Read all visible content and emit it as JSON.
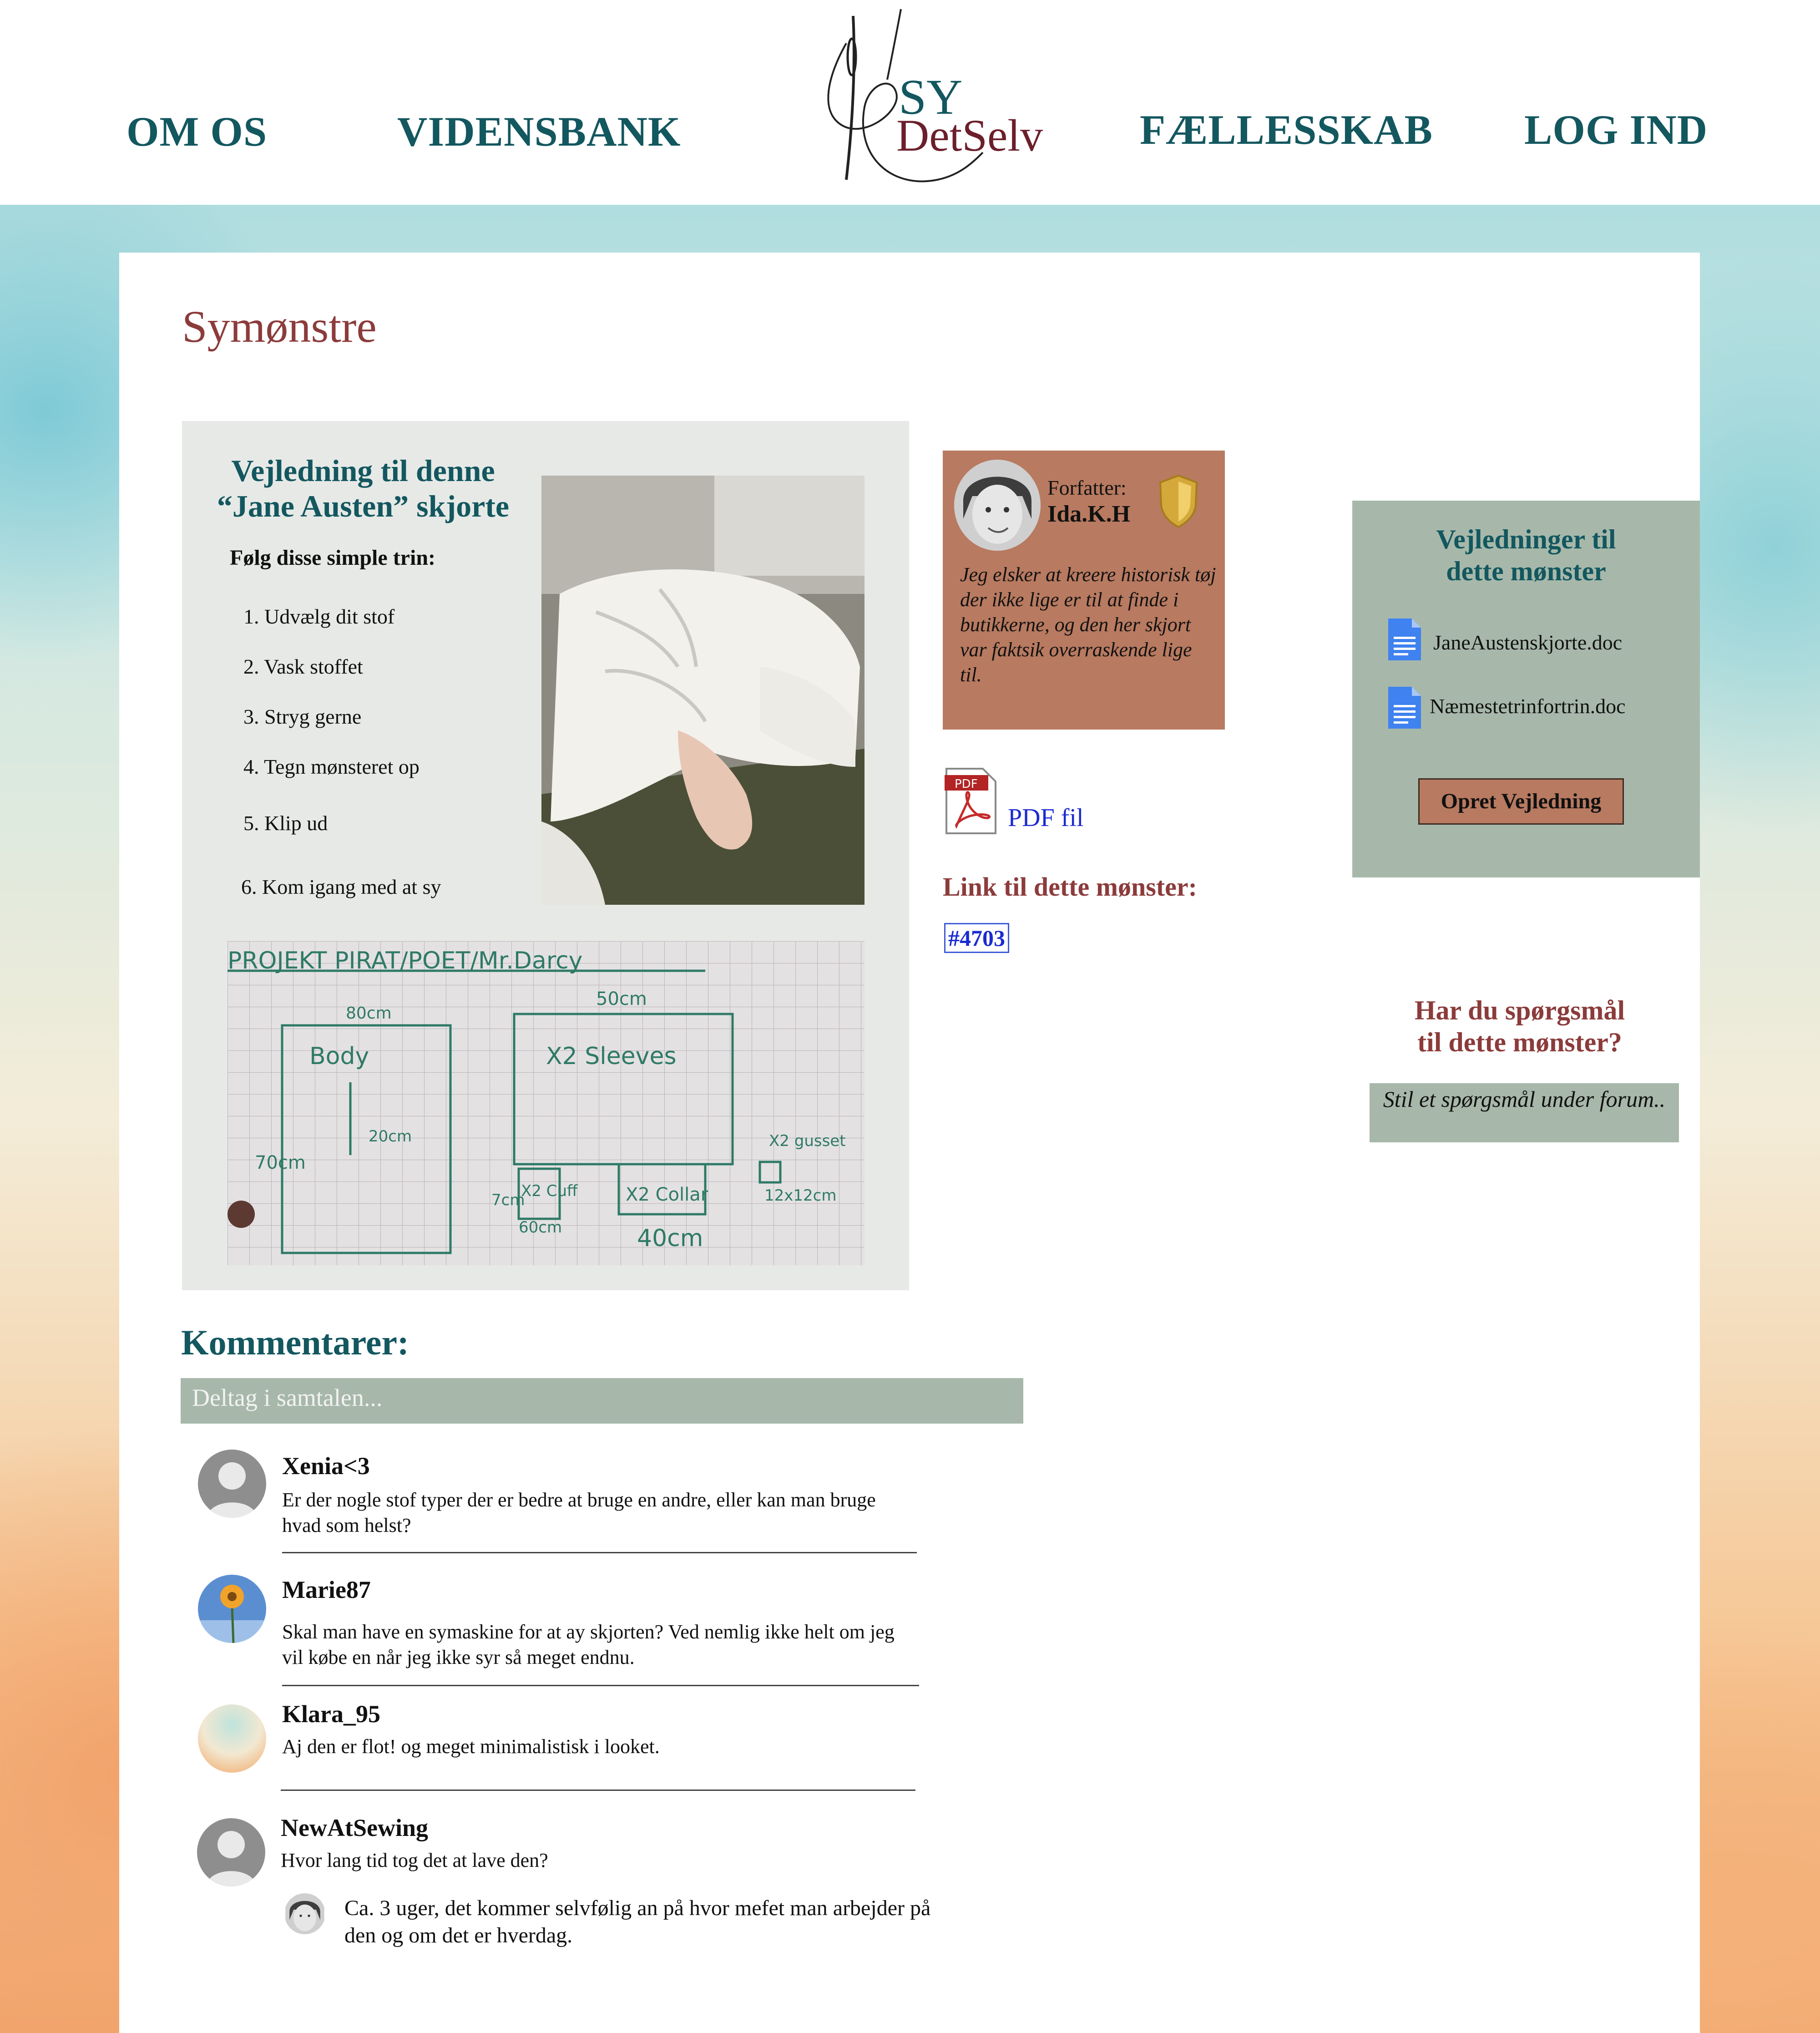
{
  "nav": {
    "items": [
      "OM OS",
      "VIDENSBANK",
      "FÆLLESSKAB",
      "LOG IND"
    ],
    "logo_line1": "SY",
    "logo_line2": "DetSelv"
  },
  "page_title": "Symønstre",
  "guide": {
    "heading_line1": "Vejledning til denne",
    "heading_line2": "“Jane Austen” skjorte",
    "intro": "Følg disse simple trin:",
    "steps": [
      "Udvælg dit stof",
      "Vask stoffet",
      "Stryg gerne",
      "Tegn mønsteret op",
      "Klip ud",
      "Kom igang med at sy"
    ],
    "step_numbers": [
      "1.",
      "2.",
      "3.",
      "4.",
      "5.",
      "6."
    ]
  },
  "author": {
    "label": "Forfatter:",
    "name": "Ida.K.H",
    "bio": "Jeg elsker at kreere historisk tøj der ikke lige er til at finde i butikkerne, og den her skjort var faktsik overraskende lige til."
  },
  "pdf": {
    "badge": "PDF",
    "label": "PDF fil"
  },
  "pattern_link": {
    "label": "Link til dette mønster:",
    "value": "#4703"
  },
  "guides_panel": {
    "heading_line1": "Vejledninger til",
    "heading_line2": "dette mønster",
    "documents": [
      "JaneAustenskjorte.doc",
      "Næmestetrinfortrin.doc"
    ],
    "create_button": "Opret Vejledning"
  },
  "questions": {
    "heading_line1": "Har du spørgsmål",
    "heading_line2": "til dette mønster?",
    "ask_text": "Stil et spørgsmål under forum.."
  },
  "comments": {
    "heading": "Kommentarer:",
    "input_placeholder": "Deltag i samtalen...",
    "items": [
      {
        "user": "Xenia<3",
        "text": "Er der nogle stof typer der er bedre at bruge en andre, eller kan man bruge hvad som helst?"
      },
      {
        "user": "Marie87",
        "text": "Skal man have en symaskine for at ay skjorten? Ved nemlig ikke helt om jeg vil købe en når jeg ikke syr så meget endnu."
      },
      {
        "user": "Klara_95",
        "text": "Aj den er flot! og meget minimalistisk i looket."
      },
      {
        "user": "NewAtSewing",
        "text": "Hvor lang tid tog det at lave den?"
      }
    ],
    "reply": {
      "text": "Ca. 3 uger, det kommer selvfølig an på hvor mefet man arbejder på den og om det er hverdag."
    }
  },
  "sketch": {
    "title": "PROJEKT PIRAT/POET/Mr.Darcy",
    "labels": [
      "Body",
      "X2 Sleeves",
      "X2 Collar",
      "X2 Cuff",
      "X2 gusset",
      "12x12cm",
      "40cm",
      "50cm",
      "80cm",
      "70cm",
      "60cm",
      "20cm",
      "7cm"
    ]
  },
  "colors": {
    "teal": "#13575f",
    "maroon": "#8c3b3b",
    "sage": "#a7b8aa",
    "terracotta": "#b87a60",
    "link_blue": "#1b2bd0"
  }
}
